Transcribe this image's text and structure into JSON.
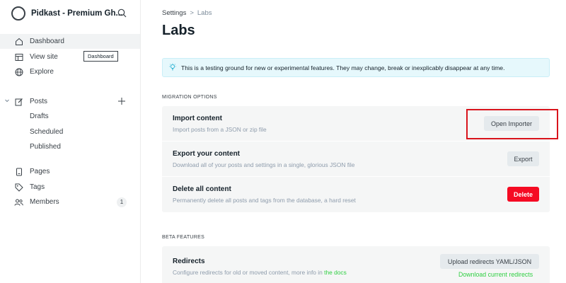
{
  "sidebar": {
    "brand_name": "Pidkast - Premium Gh...",
    "nav": [
      {
        "label": "Dashboard",
        "icon": "home-icon"
      },
      {
        "label": "View site",
        "icon": "window-icon"
      },
      {
        "label": "Explore",
        "icon": "globe-icon"
      },
      {
        "label": "Posts",
        "icon": "edit-icon"
      },
      {
        "label": "Drafts"
      },
      {
        "label": "Scheduled"
      },
      {
        "label": "Published"
      },
      {
        "label": "Pages",
        "icon": "pages-icon"
      },
      {
        "label": "Tags",
        "icon": "tag-icon"
      },
      {
        "label": "Members",
        "icon": "members-icon",
        "count": "1"
      }
    ],
    "tooltip": "Dashboard"
  },
  "header": {
    "breadcrumb_parent": "Settings",
    "breadcrumb_separator": ">",
    "breadcrumb_current": "Labs",
    "title": "Labs"
  },
  "notice": {
    "text": "This is a testing ground for new or experimental features. They may change, break or inexplicably disappear at any time."
  },
  "migration": {
    "section_label": "MIGRATION OPTIONS",
    "rows": [
      {
        "title": "Import content",
        "description": "Import posts from a JSON or zip file",
        "button": "Open Importer"
      },
      {
        "title": "Export your content",
        "description": "Download all of your posts and settings in a single, glorious JSON file",
        "button": "Export"
      },
      {
        "title": "Delete all content",
        "description": "Permanently delete all posts and tags from the database, a hard reset",
        "button": "Delete"
      }
    ]
  },
  "beta": {
    "section_label": "BETA FEATURES",
    "redirects": {
      "title": "Redirects",
      "description": "Configure redirects for old or moved content, more info in",
      "link": "the docs",
      "button": "Upload redirects YAML/JSON",
      "download_link": "Download current redirects"
    }
  },
  "colors": {
    "accent_green": "#30cf43",
    "danger_red": "#f50b23",
    "highlight_red": "#d9141c"
  }
}
